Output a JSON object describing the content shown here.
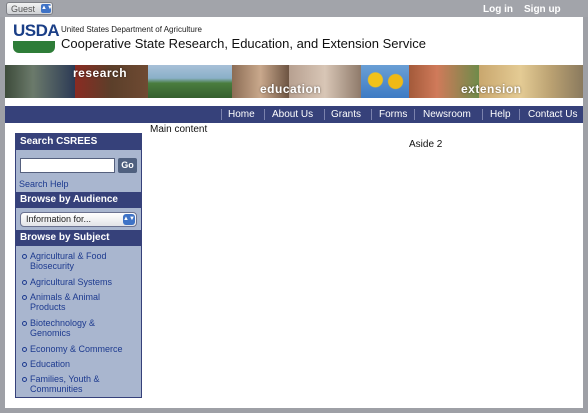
{
  "topbar": {
    "guest_label": "Guest",
    "login_label": "Log in",
    "signup_label": "Sign up"
  },
  "header": {
    "logo_text": "USDA",
    "department": "United States Department of Agriculture",
    "agency": "Cooperative State Research, Education, and Extension Service"
  },
  "banner": {
    "words": [
      "research",
      "education",
      "extension"
    ]
  },
  "nav": {
    "items": [
      "Home",
      "About Us",
      "Grants",
      "Forms",
      "Newsroom",
      "Help",
      "Contact Us"
    ]
  },
  "sidebar": {
    "search_heading": "Search CSREES",
    "go_label": "Go",
    "search_help": "Search Help",
    "audience_heading": "Browse by Audience",
    "audience_selected": "Information for...",
    "subject_heading": "Browse by Subject",
    "subjects": [
      "Agricultural & Food Biosecurity",
      "Agricultural Systems",
      "Animals & Animal Products",
      "Biotechnology & Genomics",
      "Economy & Commerce",
      "Education",
      "Families, Youth & Communities"
    ]
  },
  "main": {
    "content_label": "Main content",
    "aside_label": "Aside 2"
  },
  "colors": {
    "nav_bg": "#36417a",
    "sidebar_bg": "#a9b6cf",
    "link": "#1d3a8f",
    "logo_green": "#2e7d38"
  }
}
